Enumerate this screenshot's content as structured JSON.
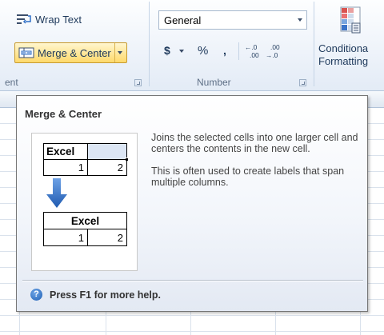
{
  "ribbon": {
    "wrap_text_label": "Wrap Text",
    "merge_center_label": "Merge & Center",
    "alignment_caption_fragment": "ent",
    "number_format_value": "General",
    "number_caption": "Number",
    "currency_symbol": "$",
    "percent_symbol": "%",
    "comma_symbol": ",",
    "increase_decimal_top": "←.0",
    "increase_decimal_bottom": ".00",
    "decrease_decimal_top": ".00",
    "decrease_decimal_bottom": "→.0",
    "conditional_formatting_line1": "Conditiona",
    "conditional_formatting_line2": "Formatting"
  },
  "tooltip": {
    "title": "Merge & Center",
    "description_1": "Joins the selected cells into one larger cell and centers the contents in the new cell.",
    "description_2": "This is often used to create labels that span multiple columns.",
    "help_text": "Press F1 for more help.",
    "illustration": {
      "before_cell_a": "Excel",
      "before_row2_a": "1",
      "before_row2_b": "2",
      "after_merged": "Excel",
      "after_row2_a": "1",
      "after_row2_b": "2"
    }
  },
  "colors": {
    "merge_highlight": "#ffd96b",
    "selection_fill": "#dce6f4",
    "arrow_blue": "#2f6fc7"
  }
}
